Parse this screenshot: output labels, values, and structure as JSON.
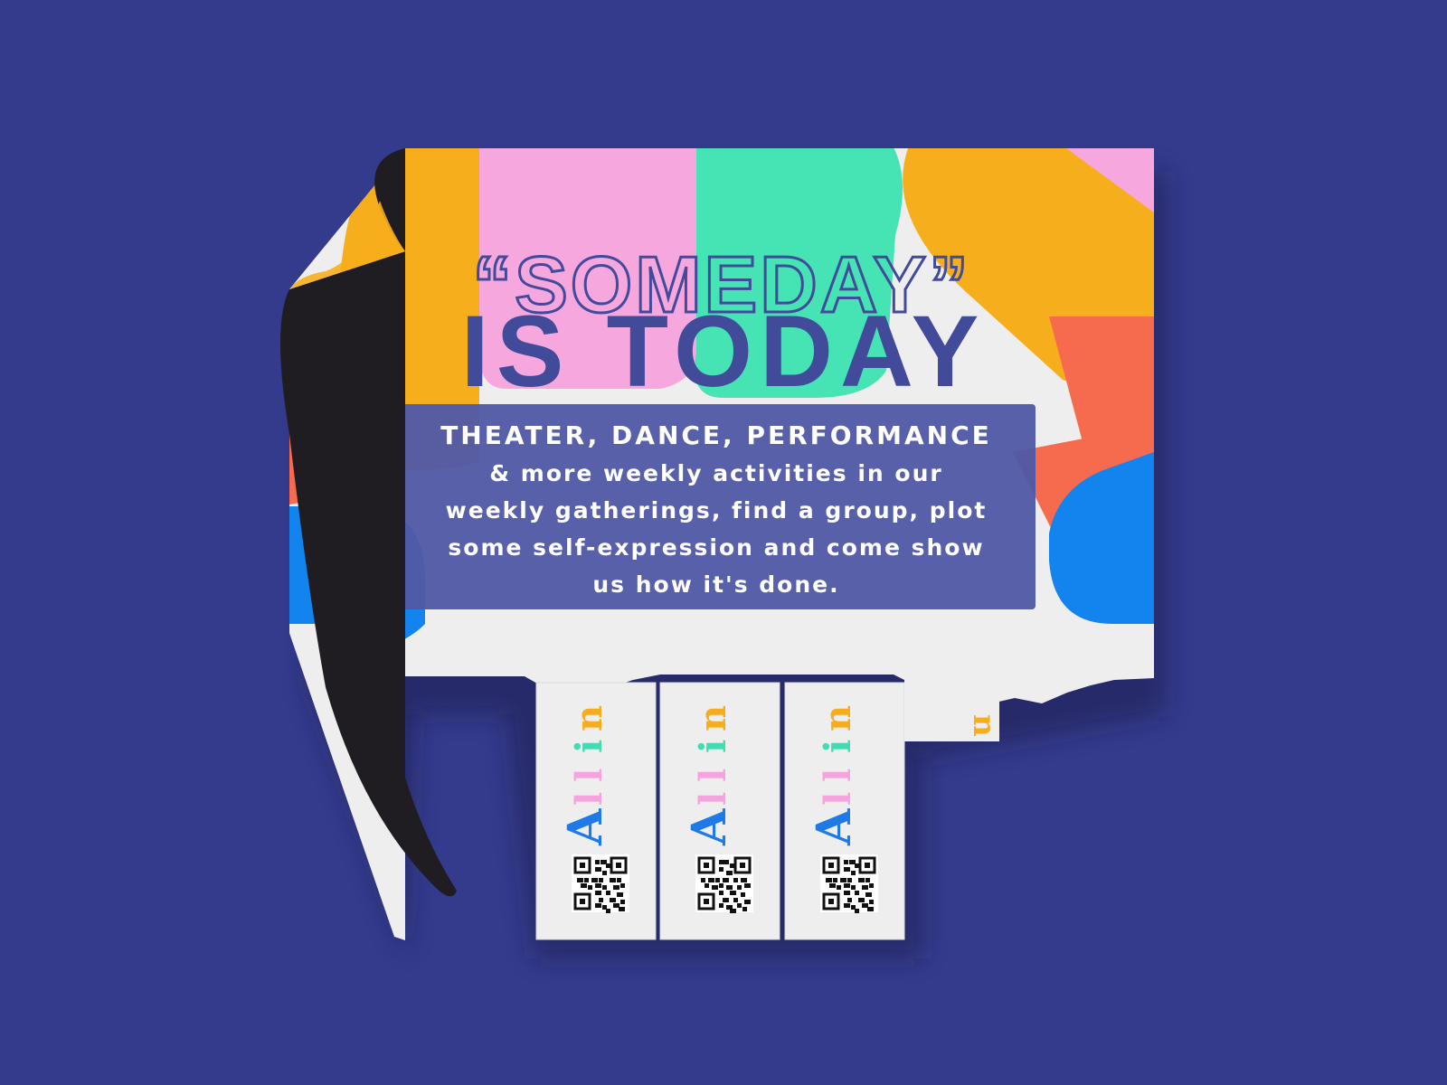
{
  "headline": {
    "line1": "“SOMEDAY”",
    "line2": "IS TODAY"
  },
  "panel": {
    "heading": "THEATER, DANCE, PERFORMANCE",
    "lines": [
      "& more weekly activities in our",
      "weekly gatherings, find a group, plot",
      "some self-expression and come show",
      "us how it's done."
    ]
  },
  "tabs": {
    "logo": {
      "parts": [
        "A",
        "l",
        "l",
        "i",
        "n"
      ],
      "colors": [
        "#1f7ae8",
        "#f4a3dc",
        "#f4a3dc",
        "#43dcb1",
        "#f5ad1d"
      ]
    },
    "count_visible": 3
  },
  "colors": {
    "background": "#343b8c",
    "navy_text": "#424a9a",
    "panel": "#505aa6",
    "paper": "#eeeeee",
    "pink": "#f6a8de",
    "mint": "#46e3b5",
    "yellow": "#f7ae1c",
    "orange": "#f66b4e",
    "blue": "#1383ee",
    "curl_dark": "#1f1d22"
  },
  "icons": {
    "qr": "qr-code-icon",
    "curl": "page-curl"
  }
}
